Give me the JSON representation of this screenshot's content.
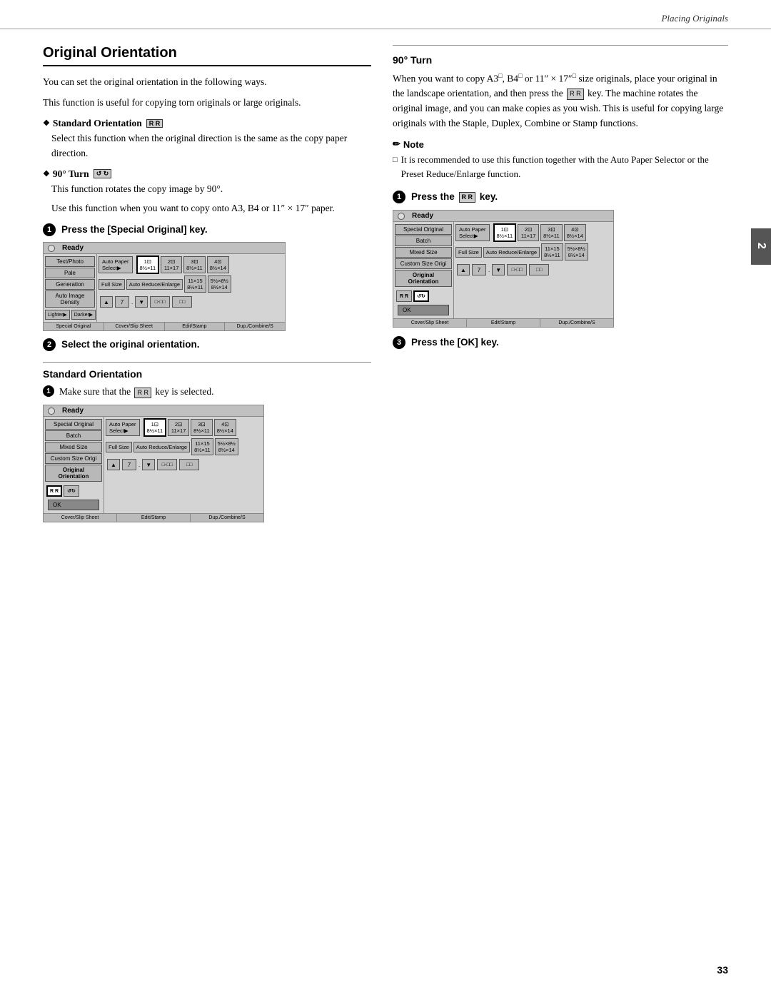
{
  "header": {
    "title": "Placing Originals"
  },
  "page_number": "33",
  "section_tab": "2",
  "left_col": {
    "section_title": "Original Orientation",
    "intro_p1": "You can set the original orientation in the following ways.",
    "intro_p2": "This function is useful for copying torn originals or large originals.",
    "bullet1_label": "Standard Orientation",
    "bullet1_icon": "⊡⊡",
    "bullet1_text": "Select this function when the original direction is the same as the copy paper direction.",
    "bullet2_label": "90° Turn",
    "bullet2_icon": "⊡⊡",
    "bullet2_text1": "This function rotates the copy image by 90°.",
    "bullet2_text2": "Use this function when you want to copy onto A3, B4 or 11″ × 17″ paper.",
    "step1_label": "Press the [Special Original] key.",
    "step2_label": "Select the original orientation.",
    "std_orientation_title": "Standard Orientation",
    "std_step1_label": "Make sure that the",
    "std_step1_icon": "⊡⊡",
    "std_step1_label2": "key is selected.",
    "ui1": {
      "ready": "Ready",
      "left_btns": [
        "Text/Photo",
        "Pale",
        "Generation",
        "Auto Image Density"
      ],
      "left_btns2": [
        "Lighter▶",
        "Darker▶"
      ],
      "bottom_btns": [
        "Special Original",
        "Cover/Slip Sheet",
        "Edit/Stamp",
        "Dup./Combine/S"
      ],
      "paper_select": "Auto Paper\nSelect▶",
      "paper_sizes": [
        "1⊡\n8½×11",
        "2⊡\n11×17",
        "3⊡\n8½×11",
        "4⊡\n8½×14"
      ],
      "full_size": "Full Size",
      "auto_reduce": "Auto Reduce/Enlarge",
      "sizes2": [
        "11×15\n8½×11",
        "5½×8½\n8½×14"
      ]
    },
    "ui2": {
      "ready": "Ready",
      "left_btns": [
        "Special Original",
        "Batch",
        "Mixed Size",
        "Custom Size Origi",
        "Original Orientation"
      ],
      "paper_select": "Auto Paper\nSelect▶",
      "paper_sizes": [
        "1⊡\n8½×11",
        "2⊡\n11×17",
        "3⊡\n8½×11",
        "4⊡\n8½×14"
      ],
      "full_size": "Full Size",
      "auto_reduce": "Auto Reduce/Enlarge",
      "sizes2": [
        "11×15\n8½×11",
        "5½×8½\n8½×14"
      ],
      "orient_btns": [
        "⊡⊡",
        "⊡⊡"
      ],
      "ok": "OK",
      "bottom_btns": [
        "Cover/Slip Sheet",
        "Edit/Stamp",
        "Dup./Combine/S"
      ]
    }
  },
  "right_col": {
    "section_90turn_title": "90° Turn",
    "p1": "When you want to copy A3",
    "p1_icon1": "□",
    "p1_cont1": ", B4",
    "p1_icon2": "□",
    "p1_cont2": "or 11″ × 17″",
    "p1_icon3": "□",
    "p1_cont3": "size originals, place your original in the landscape orientation, and then press the",
    "p1_icon4": "⊡⊡",
    "p1_cont4": "key. The machine rotates the original image, and you can make copies as you wish. This is useful for copying large originals with the Staple, Duplex, Combine or Stamp functions.",
    "note_title": "Note",
    "note_item": "It is recommended to use this function together with the Auto Paper Selector or the Preset Reduce/Enlarge function.",
    "step1_label": "Press the",
    "step1_icon": "⊡⊡",
    "step1_label2": "key.",
    "step3_label": "Press the [OK] key.",
    "ui3": {
      "ready": "Ready",
      "left_btns": [
        "Special Original",
        "Batch",
        "Mixed Size"
      ],
      "paper_select": "Auto Paper\nSelect▶",
      "paper_sizes": [
        "1⊡\n8½×11",
        "2⊡\n11×17",
        "3⊡\n8½×11",
        "4⊡\n8½×14"
      ],
      "full_size": "Full Size",
      "auto_reduce": "Auto Reduce/Enlarge",
      "sizes2": [
        "11×15\n8½×11",
        "5½×8½\n8½×14"
      ],
      "custom": "Custom Size Origi",
      "original_orient": "Original Orientation",
      "orient_btns": [
        "⊡⊡",
        "⊡⊡"
      ],
      "ok": "OK",
      "bottom_btns": [
        "Cover/Slip Sheet",
        "Edit/Stamp",
        "Dup./Combine/S"
      ]
    }
  }
}
